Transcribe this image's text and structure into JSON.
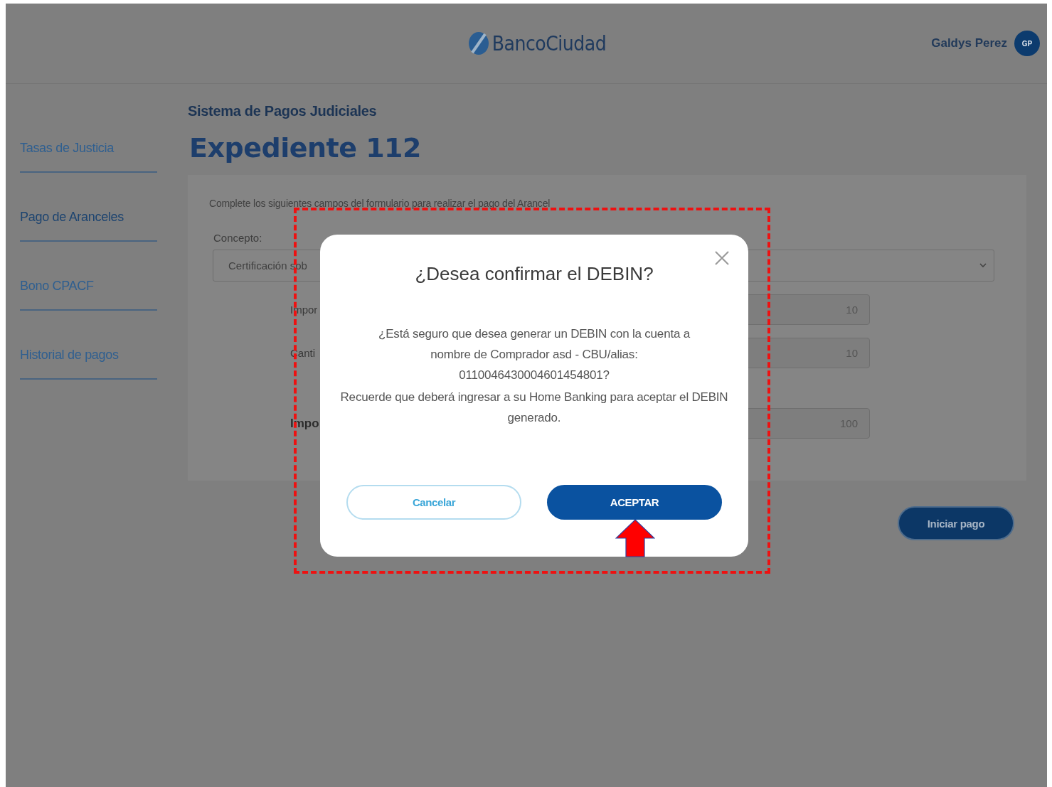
{
  "header": {
    "logo_text": "BancoCiudad",
    "user_name": "Galdys Perez",
    "user_initials": "GP"
  },
  "sidebar": {
    "items": [
      {
        "label": "Tasas de Justicia",
        "selected": false
      },
      {
        "label": "Pago de Aranceles",
        "selected": true
      },
      {
        "label": "Bono CPACF",
        "selected": false
      },
      {
        "label": "Historial de pagos",
        "selected": false
      }
    ]
  },
  "breadcrumb": "Sistema de Pagos Judiciales",
  "title": "Expediente 112",
  "form": {
    "instruction": "Complete los siguientes campos del formulario para realizar el pago del Arancel",
    "concept_label": "Concepto:",
    "concept_value": "Certificación sob",
    "fields": [
      {
        "label": "Impor",
        "value": "10",
        "kind": "plain"
      },
      {
        "label": "Canti",
        "value": "10",
        "kind": "plain"
      },
      {
        "label": "Impo",
        "value": "100",
        "kind": "total"
      }
    ],
    "submit": "Iniciar pago"
  },
  "modal": {
    "title": "¿Desea confirmar el DEBIN?",
    "message": "¿Está seguro que desea generar un DEBIN con la cuenta a nombre de Comprador asd - CBU/alias: 0110046430004601454801?",
    "note": "Recuerde que deberá ingresar a su Home Banking para aceptar el DEBIN generado.",
    "cancel": "Cancelar",
    "accept": "ACEPTAR"
  }
}
